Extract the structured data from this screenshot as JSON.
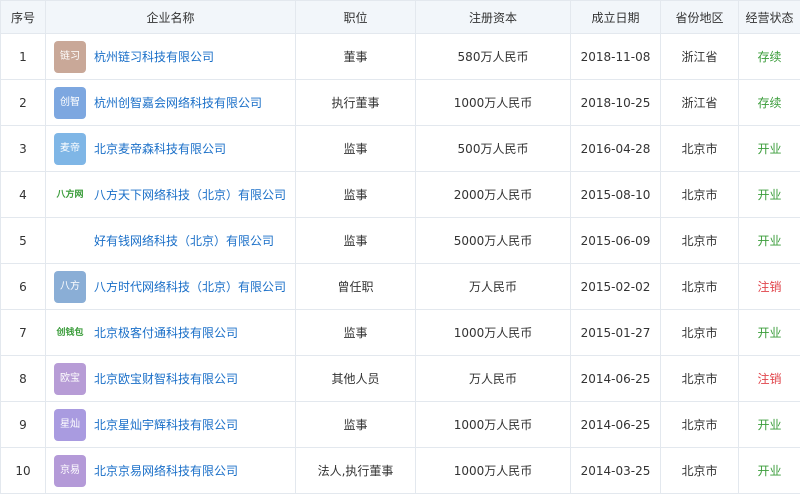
{
  "headers": [
    "序号",
    "企业名称",
    "职位",
    "注册资本",
    "成立日期",
    "省份地区",
    "经营状态"
  ],
  "rows": [
    {
      "no": "1",
      "logo": "链习",
      "logo_color": "#c9a898",
      "name": "杭州链习科技有限公司",
      "position": "董事",
      "capital": "580万人民币",
      "date": "2018-11-08",
      "region": "浙江省",
      "status": "存续",
      "status_type": "ok"
    },
    {
      "no": "2",
      "logo": "创智",
      "logo_color": "#7da7e0",
      "name": "杭州创智嘉会网络科技有限公司",
      "position": "执行董事",
      "capital": "1000万人民币",
      "date": "2018-10-25",
      "region": "浙江省",
      "status": "存续",
      "status_type": "ok"
    },
    {
      "no": "3",
      "logo": "麦帝",
      "logo_color": "#7fb6e6",
      "name": "北京麦帝森科技有限公司",
      "position": "监事",
      "capital": "500万人民币",
      "date": "2016-04-28",
      "region": "北京市",
      "status": "开业",
      "status_type": "ok"
    },
    {
      "no": "4",
      "logo": "八方网",
      "logo_color": "#ffffff",
      "name": "八方天下网络科技（北京）有限公司",
      "position": "监事",
      "capital": "2000万人民币",
      "date": "2015-08-10",
      "region": "北京市",
      "status": "开业",
      "status_type": "ok"
    },
    {
      "no": "5",
      "logo": "",
      "logo_color": "#ffffff",
      "name": "好有钱网络科技（北京）有限公司",
      "position": "监事",
      "capital": "5000万人民币",
      "date": "2015-06-09",
      "region": "北京市",
      "status": "开业",
      "status_type": "ok"
    },
    {
      "no": "6",
      "logo": "八方",
      "logo_color": "#8aaed6",
      "name": "八方时代网络科技（北京）有限公司",
      "position": "曾任职",
      "capital": "万人民币",
      "date": "2015-02-02",
      "region": "北京市",
      "status": "注销",
      "status_type": "cancel"
    },
    {
      "no": "7",
      "logo": "创钱包",
      "logo_color": "#ffffff",
      "name": "北京极客付通科技有限公司",
      "position": "监事",
      "capital": "1000万人民币",
      "date": "2015-01-27",
      "region": "北京市",
      "status": "开业",
      "status_type": "ok"
    },
    {
      "no": "8",
      "logo": "欧宝",
      "logo_color": "#b79cd6",
      "name": "北京欧宝财智科技有限公司",
      "position": "其他人员",
      "capital": "万人民币",
      "date": "2014-06-25",
      "region": "北京市",
      "status": "注销",
      "status_type": "cancel"
    },
    {
      "no": "9",
      "logo": "星灿",
      "logo_color": "#a99be0",
      "name": "北京星灿宇辉科技有限公司",
      "position": "监事",
      "capital": "1000万人民币",
      "date": "2014-06-25",
      "region": "北京市",
      "status": "开业",
      "status_type": "ok"
    },
    {
      "no": "10",
      "logo": "京易",
      "logo_color": "#b49ad8",
      "name": "北京京易网络科技有限公司",
      "position": "法人,执行董事",
      "capital": "1000万人民币",
      "date": "2014-03-25",
      "region": "北京市",
      "status": "开业",
      "status_type": "ok"
    }
  ]
}
